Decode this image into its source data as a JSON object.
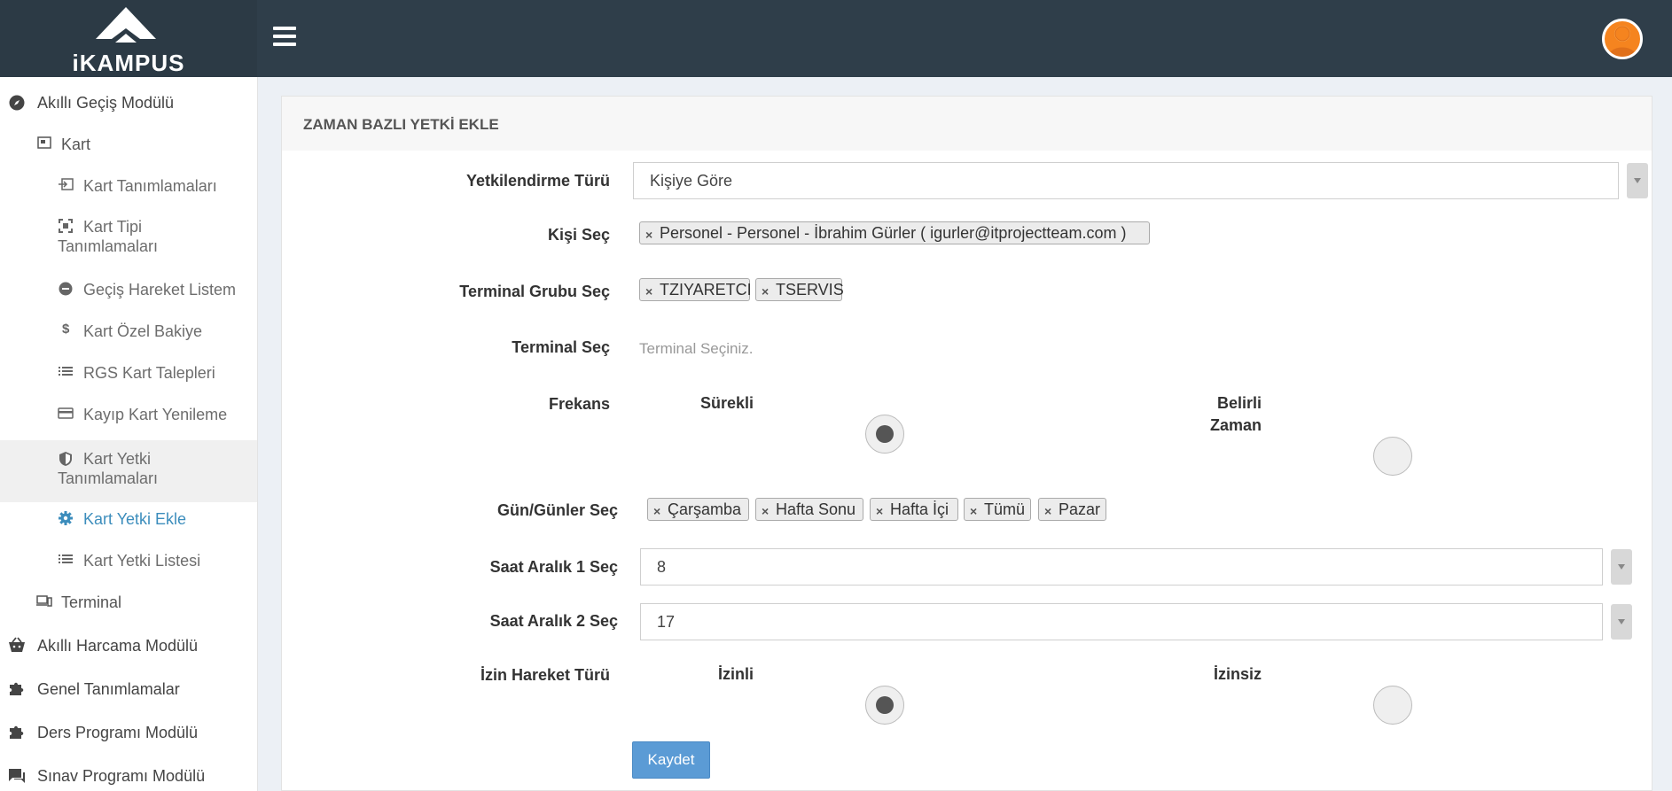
{
  "header": {
    "logo_text": "iKAMPUS",
    "logo_icon": "mountain-logo",
    "menu_icon": "hamburger-icon",
    "user_icon": "user-avatar-icon"
  },
  "sidebar": {
    "items": [
      {
        "label": "Akıllı Geçiş Modülü",
        "icon": "compass-icon"
      },
      {
        "label": "Kart",
        "icon": "card-icon"
      },
      {
        "label": "Kart Tanımlamaları",
        "icon": "sign-in-icon"
      },
      {
        "label": "Kart Tipi Tanımlamaları",
        "icon": "expand-icon"
      },
      {
        "label": "Geçiş Hareket Listem",
        "icon": "minus-circle-icon"
      },
      {
        "label": "Kart Özel Bakiye",
        "icon": "dollar-icon"
      },
      {
        "label": "RGS Kart Talepleri",
        "icon": "list-icon"
      },
      {
        "label": "Kayıp Kart Yenileme",
        "icon": "credit-card-icon"
      },
      {
        "label": "Kart Yetki Tanımlamaları",
        "icon": "shield-icon"
      },
      {
        "label": "Kart Yetki Ekle",
        "icon": "gear-icon"
      },
      {
        "label": "Kart Yetki Listesi",
        "icon": "list-icon"
      },
      {
        "label": "Terminal",
        "icon": "devices-icon"
      },
      {
        "label": "Akıllı Harcama Modülü",
        "icon": "basket-icon"
      },
      {
        "label": "Genel Tanımlamalar",
        "icon": "puzzle-icon"
      },
      {
        "label": "Ders Programı Modülü",
        "icon": "puzzle-icon"
      },
      {
        "label": "Sınav Programı Modülü",
        "icon": "chat-icon"
      }
    ]
  },
  "form": {
    "title": "ZAMAN BAZLI YETKİ EKLE",
    "auth_type_label": "Yetkilendirme Türü",
    "auth_type_value": "Kişiye Göre",
    "person_label": "Kişi Seç",
    "person_tags": [
      "Personel - Personel - İbrahim Gürler ( igurler@itprojectteam.com )"
    ],
    "terminal_group_label": "Terminal Grubu Seç",
    "terminal_group_tags": [
      "TZIYARETCI",
      "TSERVIS"
    ],
    "terminal_label": "Terminal Seç",
    "terminal_placeholder": "Terminal Seçiniz.",
    "frequency_label": "Frekans",
    "frequency_option_1": "Sürekli",
    "frequency_option_2_line1": "Belirli",
    "frequency_option_2_line2": "Zaman",
    "frequency_selected": "Sürekli",
    "days_label": "Gün/Günler Seç",
    "day_tags": [
      "Çarşamba",
      "Hafta Sonu",
      "Hafta İçi",
      "Tümü",
      "Pazar"
    ],
    "time1_label": "Saat Aralık 1 Seç",
    "time1_value": "8",
    "time2_label": "Saat Aralık 2 Seç",
    "time2_value": "17",
    "permission_label": "İzin Hareket Türü",
    "permission_option_1": "İzinli",
    "permission_option_2": "İzinsiz",
    "permission_selected": "İzinli",
    "save_label": "Kaydet"
  }
}
